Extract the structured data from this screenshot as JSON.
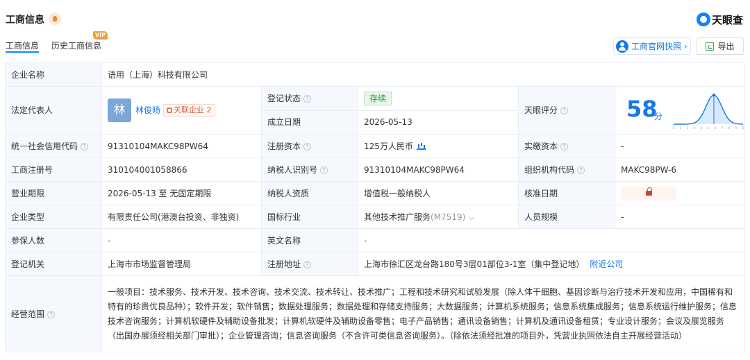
{
  "header": {
    "title": "工商信息",
    "logo": "天眼查",
    "tabs": [
      "工商信息",
      "历史工商信息"
    ],
    "vip": "VIP",
    "snapshot_button": "工商官网快照",
    "snapshot_chevron": "›",
    "export_button": "导出"
  },
  "company": {
    "name_label": "企业名称",
    "name": "语用（上海）科技有限公司",
    "legal_rep_label": "法定代表人",
    "legal_rep_avatar": "林",
    "legal_rep": "林俊旸",
    "related_companies": "关联企业 2",
    "status_label": "登记状态",
    "status": "存续",
    "established_label": "成立日期",
    "established": "2026-05-13",
    "score_label": "天眼评分",
    "score": "58",
    "score_unit": "分",
    "credit_code_label": "统一社会信用代码",
    "credit_code": "91310104MAKC98PW64",
    "registered_capital_label": "注册资本",
    "registered_capital": "125万人民币",
    "paid_capital_label": "实缴资本",
    "paid_capital": "-",
    "registration_no_label": "工商注册号",
    "registration_no": "310104001058866",
    "taxpayer_id_label": "纳税人识别号",
    "taxpayer_id": "91310104MAKC98PW64",
    "organization_code_label": "组织机构代码",
    "organization_code": "MAKC98PW-6",
    "business_term_label": "营业期限",
    "business_term": "2026-05-13 至 无固定期限",
    "taxpayer_qualification_label": "纳税人资质",
    "taxpayer_qualification": "增值税一般纳税人",
    "approval_date_label": "核准日期",
    "company_type_label": "企业类型",
    "company_type": "有限责任公司(港澳台投资、非独资)",
    "industry_label": "国标行业",
    "industry": "其他技术推广服务",
    "industry_code": "(M7519)",
    "industry_chevron": "⌵",
    "staff_size_label": "人员规模",
    "staff_size": "-",
    "insured_label": "参保人数",
    "insured": "-",
    "english_name_label": "英文名称",
    "english_name": "-",
    "authority_label": "登记机关",
    "authority": "上海市市场监督管理局",
    "address_label": "注册地址",
    "address": "上海市徐汇区龙台路180号3层01部位3-1室（集中登记地）",
    "nearby_link": "附近公司",
    "scope_label": "经营范围",
    "scope": "一般项目：技术服务、技术开发、技术咨询、技术交流、技术转让、技术推广；工程和技术研究和试验发展（除人体干细胞、基因诊断与治疗技术开发和应用，中国稀有和特有的珍贵优良品种）；软件开发；软件销售；数据处理服务；数据处理和存储支持服务；大数据服务；计算机系统服务；信息系统集成服务；信息系统运行维护服务；信息技术咨询服务；计算机软硬件及辅助设备批发；计算机软硬件及辅助设备零售；电子产品销售；通讯设备销售；计算机及通讯设备租赁；专业设计服务；会议及展览服务（出国办展须经相关部门审批）；企业管理咨询；信息咨询服务（不含许可类信息咨询服务）。（除依法须经批准的项目外，凭营业执照依法自主开展经营活动）"
  },
  "score_chart": {
    "x_ticks": [
      "0",
      "1",
      "2",
      "3",
      "4",
      "5",
      "6",
      "7",
      "8",
      "9",
      "10"
    ],
    "marker_score": 58,
    "colors": {
      "line": "#1777e6",
      "fill": "#d8eaff"
    }
  },
  "icons": {
    "title_dot": "hot-icon",
    "logo": "tianyancha-logo-icon",
    "snapshot": "user-icon",
    "export": "excel-icon",
    "help": "help-icon",
    "related": "related-company-icon",
    "capital": "chart-icon",
    "lock": "lock-icon"
  }
}
